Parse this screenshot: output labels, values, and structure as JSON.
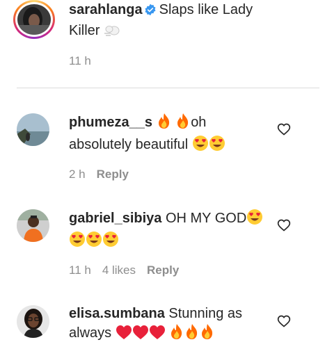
{
  "comments": [
    {
      "username": "sarahlanga",
      "verified": true,
      "text_before": "Slaps like Lady Killer",
      "time": "11 h"
    },
    {
      "username": "phumeza__s",
      "text_a": "oh absolutely beautiful",
      "time": "2 h",
      "reply_label": "Reply"
    },
    {
      "username": "gabriel_sibiya",
      "text_a": "OH MY GOD",
      "time": "11 h",
      "likes": "4 likes",
      "reply_label": "Reply"
    },
    {
      "username": "elisa.sumbana",
      "text_a": "Stunning as always"
    }
  ],
  "icons": {
    "verified": "verified-badge-icon",
    "like": "heart-outline-icon",
    "emoji_fire": "fire-emoji",
    "emoji_heart_eyes": "heart-eyes-emoji",
    "emoji_red_heart": "red-heart-emoji",
    "emoji_dash": "dash-emoji"
  },
  "colors": {
    "username": "#262626",
    "meta": "#8e8e8e",
    "verified": "#3897f0",
    "divider": "#dbdbdb"
  }
}
